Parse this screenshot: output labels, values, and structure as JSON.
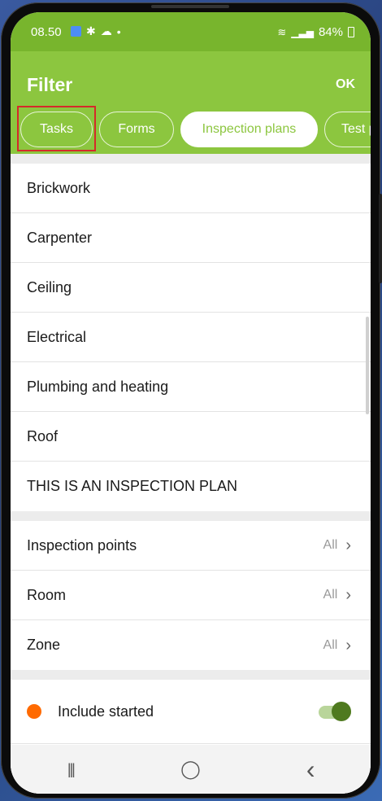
{
  "status_bar": {
    "time": "08.50",
    "battery": "84%",
    "icons": [
      "app-icon",
      "settings-icon",
      "cloud-icon",
      "dot-icon",
      "wifi-icon",
      "signal-icon",
      "battery-icon"
    ]
  },
  "app_bar": {
    "title": "Filter",
    "ok_label": "OK"
  },
  "tabs": [
    {
      "label": "Tasks",
      "active": false
    },
    {
      "label": "Forms",
      "active": false
    },
    {
      "label": "Inspection plans",
      "active": true
    },
    {
      "label": "Test p",
      "active": false
    }
  ],
  "plans": [
    "Brickwork",
    "Carpenter",
    "Ceiling",
    "Electrical",
    "Plumbing and heating",
    "Roof",
    "THIS IS AN INSPECTION PLAN"
  ],
  "filters": [
    {
      "label": "Inspection points",
      "value": "All"
    },
    {
      "label": "Room",
      "value": "All"
    },
    {
      "label": "Zone",
      "value": "All"
    }
  ],
  "options": {
    "include_started": {
      "label": "Include started",
      "enabled": true,
      "dot_color": "#ff6a00"
    }
  },
  "nav": {
    "recent": "|||",
    "home": "◯",
    "back": "‹"
  },
  "colors": {
    "status_bar": "#78b52d",
    "app_bar": "#8cc63f",
    "highlight": "#d42a2a",
    "toggle_knob": "#4f7a1f"
  }
}
